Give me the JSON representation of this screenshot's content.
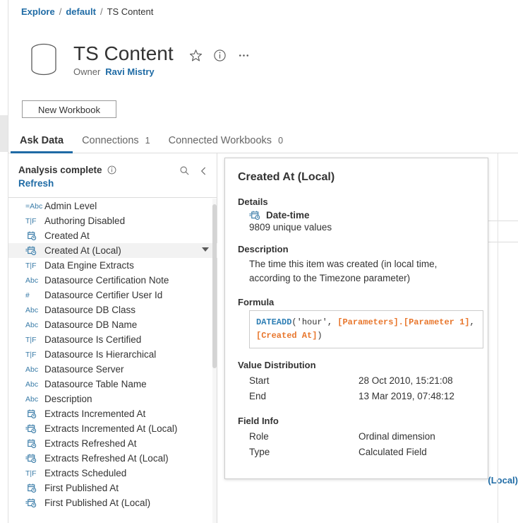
{
  "breadcrumb": {
    "items": [
      {
        "label": "Explore",
        "type": "link"
      },
      {
        "label": "default",
        "type": "link"
      },
      {
        "label": "TS Content",
        "type": "current"
      }
    ],
    "separator": "/"
  },
  "header": {
    "title": "TS Content",
    "datasource_icon": "database-cylinder-icon",
    "actions": [
      {
        "name": "favorite-star-icon",
        "glyph": "star"
      },
      {
        "name": "info-icon",
        "glyph": "info"
      },
      {
        "name": "more-actions-icon",
        "glyph": "ellipsis"
      }
    ],
    "owner_label": "Owner",
    "owner_name": "Ravi Mistry",
    "new_workbook_label": "New Workbook"
  },
  "tabs": [
    {
      "label": "Ask Data",
      "count": "",
      "active": true
    },
    {
      "label": "Connections",
      "count": "1",
      "active": false
    },
    {
      "label": "Connected Workbooks",
      "count": "0",
      "active": false
    }
  ],
  "panel": {
    "status": "Analysis complete",
    "status_info_icon": "info-icon",
    "refresh_label": "Refresh",
    "search_icon": "search-icon",
    "collapse_icon": "chevron-left-icon"
  },
  "fields": [
    {
      "label": "Admin Level",
      "icon": "calculated-string-icon",
      "icon_text": "=Abc",
      "selected": false
    },
    {
      "label": "Authoring Disabled",
      "icon": "boolean-icon",
      "icon_text": "T|F",
      "selected": false
    },
    {
      "label": "Created At",
      "icon": "datetime-icon",
      "icon_text": "",
      "selected": false
    },
    {
      "label": "Created At (Local)",
      "icon": "calculated-datetime-icon",
      "icon_text": "",
      "selected": true
    },
    {
      "label": "Data Engine Extracts",
      "icon": "boolean-icon",
      "icon_text": "T|F",
      "selected": false
    },
    {
      "label": "Datasource Certification Note",
      "icon": "string-icon",
      "icon_text": "Abc",
      "selected": false
    },
    {
      "label": "Datasource Certifier User Id",
      "icon": "number-icon",
      "icon_text": "#",
      "selected": false
    },
    {
      "label": "Datasource DB Class",
      "icon": "string-icon",
      "icon_text": "Abc",
      "selected": false
    },
    {
      "label": "Datasource DB Name",
      "icon": "string-icon",
      "icon_text": "Abc",
      "selected": false
    },
    {
      "label": "Datasource Is Certified",
      "icon": "boolean-icon",
      "icon_text": "T|F",
      "selected": false
    },
    {
      "label": "Datasource Is Hierarchical",
      "icon": "boolean-icon",
      "icon_text": "T|F",
      "selected": false
    },
    {
      "label": "Datasource Server",
      "icon": "string-icon",
      "icon_text": "Abc",
      "selected": false
    },
    {
      "label": "Datasource Table Name",
      "icon": "string-icon",
      "icon_text": "Abc",
      "selected": false
    },
    {
      "label": "Description",
      "icon": "string-icon",
      "icon_text": "Abc",
      "selected": false
    },
    {
      "label": "Extracts Incremented At",
      "icon": "datetime-icon",
      "icon_text": "",
      "selected": false
    },
    {
      "label": "Extracts Incremented At (Local)",
      "icon": "calculated-datetime-icon",
      "icon_text": "",
      "selected": false
    },
    {
      "label": "Extracts Refreshed At",
      "icon": "datetime-icon",
      "icon_text": "",
      "selected": false
    },
    {
      "label": "Extracts Refreshed At (Local)",
      "icon": "calculated-datetime-icon",
      "icon_text": "",
      "selected": false
    },
    {
      "label": "Extracts Scheduled",
      "icon": "boolean-icon",
      "icon_text": "T|F",
      "selected": false
    },
    {
      "label": "First Published At",
      "icon": "datetime-icon",
      "icon_text": "",
      "selected": false
    },
    {
      "label": "First Published At (Local)",
      "icon": "calculated-datetime-icon",
      "icon_text": "",
      "selected": false
    }
  ],
  "background": {
    "partial_label": "(Local)"
  },
  "popover": {
    "title": "Created At (Local)",
    "details_heading": "Details",
    "data_type": "Date-time",
    "data_type_icon": "calculated-datetime-icon",
    "unique_values": "9809 unique values",
    "description_heading": "Description",
    "description_text": "The time this item was created (in local time, according to the Timezone parameter)",
    "formula_heading": "Formula",
    "formula_tokens": [
      {
        "text": "DATEADD",
        "type": "fn"
      },
      {
        "text": "(",
        "type": "punc"
      },
      {
        "text": "'hour'",
        "type": "str"
      },
      {
        "text": ", ",
        "type": "punc"
      },
      {
        "text": "[Parameters].[Parameter 1]",
        "type": "ref"
      },
      {
        "text": ", ",
        "type": "punc"
      },
      {
        "text": "[Created At]",
        "type": "ref"
      },
      {
        "text": ")",
        "type": "punc"
      }
    ],
    "value_distribution_heading": "Value Distribution",
    "value_distribution": [
      {
        "key": "Start",
        "value": "28 Oct 2010, 15:21:08"
      },
      {
        "key": "End",
        "value": "13 Mar 2019, 07:48:12"
      }
    ],
    "field_info_heading": "Field Info",
    "field_info": [
      {
        "key": "Role",
        "value": "Ordinal dimension"
      },
      {
        "key": "Type",
        "value": "Calculated Field"
      }
    ]
  },
  "colors": {
    "link": "#1f6ba5",
    "accent": "#1f6ba5",
    "icon_blue": "#3a7ca8",
    "formula_fn": "#2f7fb5",
    "formula_ref": "#e8762c",
    "selected_row": "#f2f2f2"
  }
}
